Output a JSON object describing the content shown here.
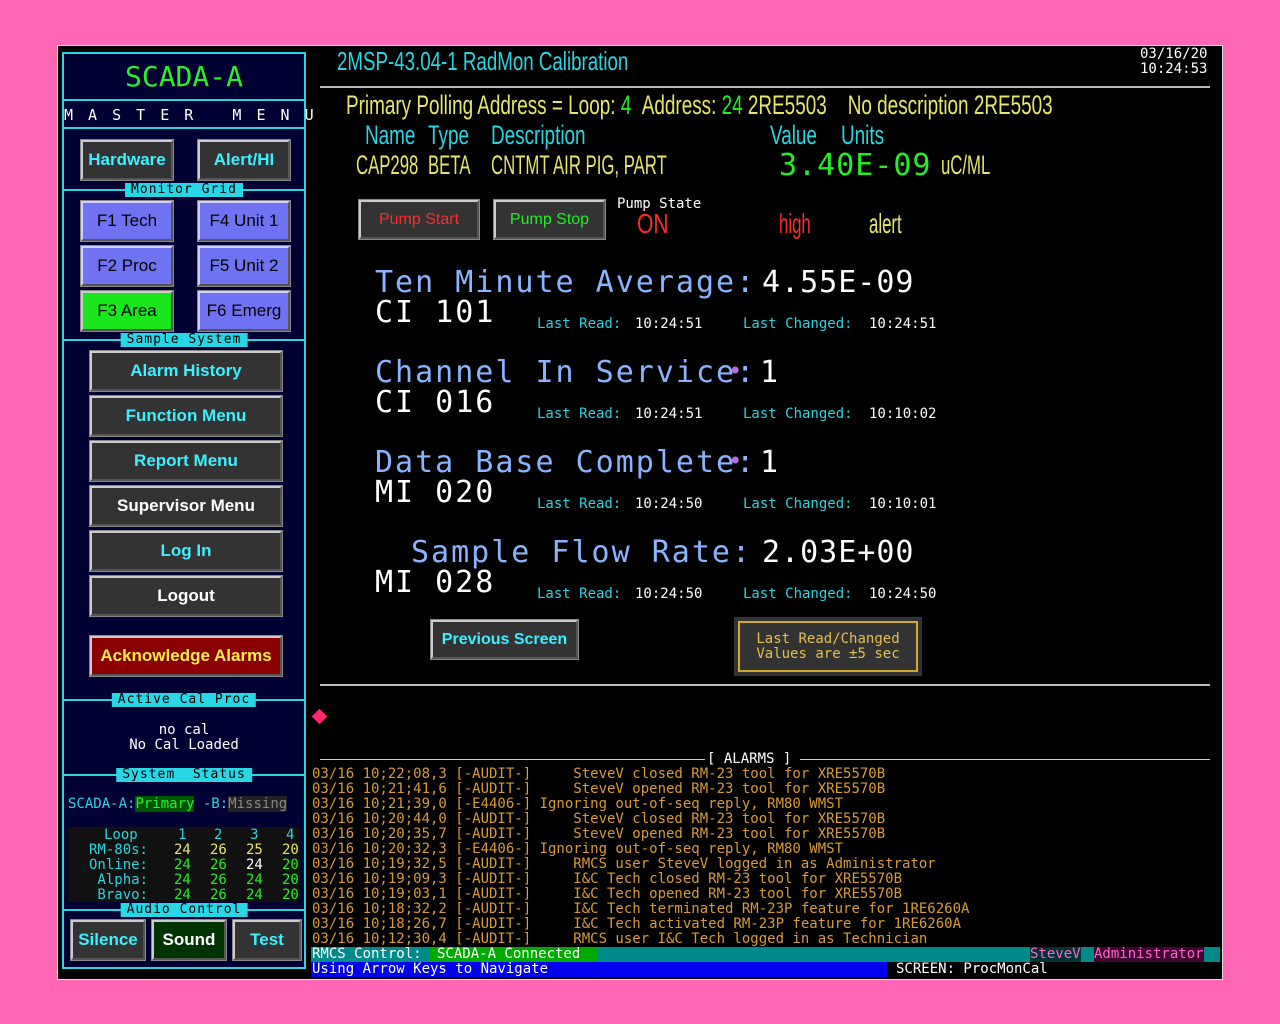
{
  "sidebar": {
    "app_title": "SCADA-A",
    "menu_title": "M A S T E R   M E N U",
    "hardware_label": "Hardware",
    "alert_hi_label": "Alert/HI",
    "monitor_grid_label": "Monitor Grid",
    "grid": {
      "f1": "F1 Tech",
      "f2": "F2 Proc",
      "f3": "F3 Area",
      "f4": "F4 Unit 1",
      "f5": "F5 Unit 2",
      "f6": "F6 Emerg"
    },
    "sample_system_label": "Sample System",
    "menu": {
      "alarm_history": "Alarm History",
      "function_menu": "Function Menu",
      "report_menu": "Report Menu",
      "supervisor_menu": "Supervisor Menu",
      "log_in": "Log In",
      "logout": "Logout",
      "acknowledge": "Acknowledge Alarms"
    },
    "active_cal_label": "Active Cal Proc",
    "cal_line1": "no cal",
    "cal_line2": "No Cal Loaded",
    "system_status_label": "System  Status",
    "status": {
      "a_label": "SCADA-A:",
      "a_value": "Primary",
      "b_label": " -B:",
      "b_value": "Missing"
    },
    "loop_table": {
      "header": [
        "Loop",
        "1",
        "2",
        "3",
        "4"
      ],
      "rows": [
        {
          "label": "RM-80s:",
          "values": [
            "24",
            "26",
            "25",
            "20"
          ]
        },
        {
          "label": "Online:",
          "values": [
            "24",
            "26",
            "24",
            "20"
          ]
        },
        {
          "label": "Alpha:",
          "values": [
            "24",
            "26",
            "24",
            "20"
          ]
        },
        {
          "label": "Bravo:",
          "values": [
            "24",
            "26",
            "24",
            "20"
          ]
        }
      ]
    },
    "audio_control_label": "Audio Control",
    "audio": {
      "silence": "Silence",
      "sound": "Sound",
      "test": "Test"
    }
  },
  "header": {
    "title": "2MSP-43.04-1 RadMon Calibration",
    "date": "03/16/20",
    "time": "10:24:53"
  },
  "polling": {
    "prefix": "Primary Polling Address = Loop:",
    "loop": "4",
    "address_label": "Address:",
    "address": "24",
    "id": "2RE5503",
    "desc": "No description 2RE5503"
  },
  "info": {
    "name_header": "Name",
    "type_header": "Type",
    "desc_header": "Description",
    "value_header": "Value",
    "units_header": "Units",
    "name": "CAP298",
    "type": "BETA",
    "description": "CNTMT AIR PIG, PART",
    "value": "3.40E-09",
    "units": "uC/ML"
  },
  "pump": {
    "start_label": "Pump Start",
    "stop_label": "Pump Stop",
    "state_label": "Pump State",
    "state_value": "ON",
    "high": "high",
    "alert": "alert"
  },
  "points": [
    {
      "title": "Ten Minute Average:",
      "value": "4.55E-09",
      "bullet": "",
      "code": "CI 101",
      "last_read_label": "Last Read:",
      "last_read": "10:24:51",
      "last_changed_label": "Last Changed:",
      "last_changed": "10:24:51"
    },
    {
      "title": "Channel In Service:",
      "value": "1",
      "bullet": "•",
      "code": "CI 016",
      "last_read_label": "Last Read:",
      "last_read": "10:24:51",
      "last_changed_label": "Last Changed:",
      "last_changed": "10:10:02"
    },
    {
      "title": "Data Base Complete:",
      "value": "1",
      "bullet": "•",
      "code": "MI 020",
      "last_read_label": "Last Read:",
      "last_read": "10:24:50",
      "last_changed_label": "Last Changed:",
      "last_changed": "10:10:01"
    },
    {
      "title": "Sample Flow Rate:",
      "value": "2.03E+00",
      "bullet": "",
      "code": "MI 028",
      "last_read_label": "Last Read:",
      "last_read": "10:24:50",
      "last_changed_label": "Last Changed:",
      "last_changed": "10:24:50"
    }
  ],
  "previous_screen_label": "Previous Screen",
  "note_line1": "Last Read/Changed",
  "note_line2": "Values are ±5 sec",
  "alarms_title": "[ ALARMS ]",
  "alarms": [
    "03/16 10;22;08,3 [-AUDIT-]     SteveV closed RM-23 tool for XRE5570B",
    "03/16 10;21;41,6 [-AUDIT-]     SteveV opened RM-23 tool for XRE5570B",
    "03/16 10;21;39,0 [-E4406-] Ignoring out-of-seq reply, RM80 WMST",
    "03/16 10;20;44,0 [-AUDIT-]     SteveV closed RM-23 tool for XRE5570B",
    "03/16 10;20;35,7 [-AUDIT-]     SteveV opened RM-23 tool for XRE5570B",
    "03/16 10;20;32,3 [-E4406-] Ignoring out-of-seq reply, RM80 WMST",
    "03/16 10;19;32,5 [-AUDIT-]     RMCS user SteveV logged in as Administrator",
    "03/16 10;19;09,3 [-AUDIT-]     I&C Tech closed RM-23 tool for XRE5570B",
    "03/16 10;19;03,1 [-AUDIT-]     I&C Tech opened RM-23 tool for XRE5570B",
    "03/16 10;18;32,2 [-AUDIT-]     I&C Tech terminated RM-23P feature for 1RE6260A",
    "03/16 10;18;26,7 [-AUDIT-]     I&C Tech activated RM-23P feature for 1RE6260A",
    "03/16 10;12;30,4 [-AUDIT-]     RMCS user I&C Tech logged in as Technician"
  ],
  "statusbar": {
    "control_label": "RMCS Control:",
    "control_value": "SCADA-A Connected",
    "user": "SteveV",
    "role": "Administrator",
    "nav_hint": "Using Arrow Keys to Navigate",
    "screen": "SCREEN: ProcMonCal"
  },
  "colors": {
    "background": "#ff66b3",
    "accent_cyan": "#2ad4e0",
    "value_green": "#22ee22",
    "yellow": "#e6e66a",
    "red": "#ff2a2a",
    "alarm_text": "#d99a3a"
  }
}
